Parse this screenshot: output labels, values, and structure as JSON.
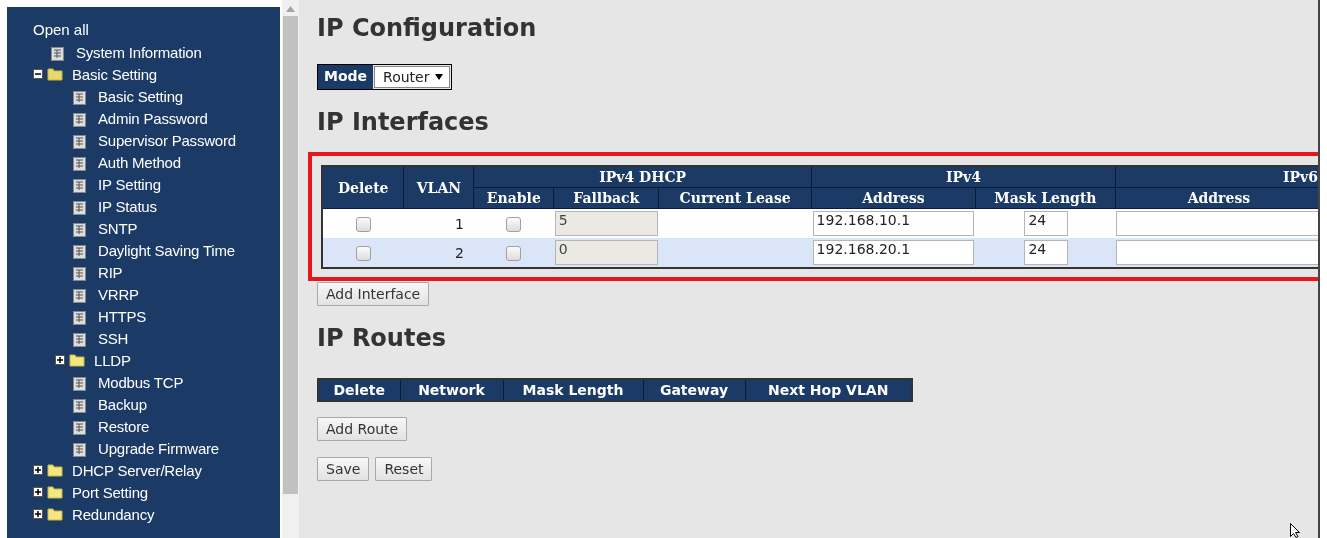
{
  "sidebar": {
    "open_all": "Open all",
    "items": [
      {
        "kind": "page",
        "label": "System Information"
      },
      {
        "kind": "folder",
        "label": "Basic Setting",
        "expanded": true,
        "children": [
          {
            "kind": "page",
            "label": "Basic Setting"
          },
          {
            "kind": "page",
            "label": "Admin Password"
          },
          {
            "kind": "page",
            "label": "Supervisor Password"
          },
          {
            "kind": "page",
            "label": "Auth Method"
          },
          {
            "kind": "page",
            "label": "IP Setting"
          },
          {
            "kind": "page",
            "label": "IP Status"
          },
          {
            "kind": "page",
            "label": "SNTP"
          },
          {
            "kind": "page",
            "label": "Daylight Saving Time"
          },
          {
            "kind": "page",
            "label": "RIP"
          },
          {
            "kind": "page",
            "label": "VRRP"
          },
          {
            "kind": "page",
            "label": "HTTPS"
          },
          {
            "kind": "page",
            "label": "SSH"
          },
          {
            "kind": "folder",
            "label": "LLDP",
            "expanded": false
          },
          {
            "kind": "page",
            "label": "Modbus TCP"
          },
          {
            "kind": "page",
            "label": "Backup"
          },
          {
            "kind": "page",
            "label": "Restore"
          },
          {
            "kind": "page",
            "label": "Upgrade Firmware"
          }
        ]
      },
      {
        "kind": "folder",
        "label": "DHCP Server/Relay",
        "expanded": false
      },
      {
        "kind": "folder",
        "label": "Port Setting",
        "expanded": false
      },
      {
        "kind": "folder",
        "label": "Redundancy",
        "expanded": false
      }
    ]
  },
  "main": {
    "title": "IP Configuration",
    "mode": {
      "label": "Mode",
      "value": "Router"
    },
    "interfaces": {
      "title": "IP Interfaces",
      "header": [
        {
          "kind": "single",
          "label": "Delete"
        },
        {
          "kind": "single",
          "label": "VLAN"
        },
        {
          "kind": "group",
          "label": "IPv4 DHCP",
          "columns": [
            "Enable",
            "Fallback",
            "Current Lease"
          ]
        },
        {
          "kind": "group",
          "label": "IPv4",
          "columns": [
            "Address",
            "Mask Length"
          ]
        },
        {
          "kind": "group",
          "label": "IPv6",
          "columns": [
            "Address"
          ]
        }
      ],
      "rows": [
        {
          "cells": [
            {
              "kind": "checkbox",
              "checked": false
            },
            {
              "kind": "number",
              "text": "1"
            },
            {
              "kind": "checkbox",
              "checked": false
            },
            {
              "kind": "input",
              "value": "5",
              "disabled": true
            },
            {
              "kind": "empty"
            },
            {
              "kind": "input",
              "value": "192.168.10.1",
              "disabled": false
            },
            {
              "kind": "short-input",
              "value": "24",
              "disabled": false
            },
            {
              "kind": "input",
              "disabled": false
            }
          ]
        },
        {
          "cells": [
            {
              "kind": "checkbox",
              "checked": false
            },
            {
              "kind": "number",
              "text": "2"
            },
            {
              "kind": "checkbox",
              "checked": false
            },
            {
              "kind": "input",
              "value": "0",
              "disabled": true
            },
            {
              "kind": "empty"
            },
            {
              "kind": "input",
              "value": "192.168.20.1",
              "disabled": false
            },
            {
              "kind": "short-input",
              "value": "24",
              "disabled": false
            },
            {
              "kind": "input",
              "disabled": false
            }
          ]
        }
      ],
      "add_button": "Add Interface"
    },
    "routes": {
      "title": "IP Routes",
      "columns": [
        "Delete",
        "Network",
        "Mask Length",
        "Gateway",
        "Next Hop VLAN"
      ],
      "add_button": "Add Route"
    },
    "buttons": [
      "Save",
      "Reset"
    ]
  }
}
